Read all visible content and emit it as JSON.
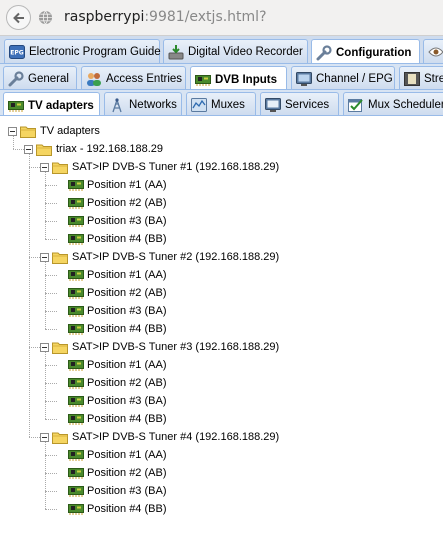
{
  "browser": {
    "url_host": "raspberrypi",
    "url_rest": ":9981/extjs.html?"
  },
  "main_tabs": [
    {
      "label": "Electronic Program Guide",
      "icon": "epg-icon"
    },
    {
      "label": "Digital Video Recorder",
      "icon": "dvr-icon"
    },
    {
      "label": "Configuration",
      "icon": "wrench-icon",
      "active": true
    },
    {
      "label": "",
      "icon": "eye-icon"
    }
  ],
  "config_tabs": [
    {
      "label": "General",
      "icon": "wrench-icon"
    },
    {
      "label": "Access Entries",
      "icon": "users-icon"
    },
    {
      "label": "DVB Inputs",
      "icon": "tuner-card-icon",
      "active": true
    },
    {
      "label": "Channel / EPG",
      "icon": "tv-icon"
    },
    {
      "label": "Stre",
      "icon": "film-icon"
    }
  ],
  "dvb_tabs": [
    {
      "label": "TV adapters",
      "icon": "tuner-card-icon",
      "active": true
    },
    {
      "label": "Networks",
      "icon": "antenna-icon"
    },
    {
      "label": "Muxes",
      "icon": "mux-icon"
    },
    {
      "label": "Services",
      "icon": "tv-services-icon"
    },
    {
      "label": "Mux Schedulers",
      "icon": "scheduler-icon"
    }
  ],
  "tree": {
    "root": "TV adapters",
    "device": "triax - 192.168.188.29",
    "tuners": [
      {
        "label": "SAT>IP DVB-S Tuner #1 (192.168.188.29)",
        "positions": [
          "Position #1 (AA)",
          "Position #2 (AB)",
          "Position #3 (BA)",
          "Position #4 (BB)"
        ]
      },
      {
        "label": "SAT>IP DVB-S Tuner #2 (192.168.188.29)",
        "positions": [
          "Position #1 (AA)",
          "Position #2 (AB)",
          "Position #3 (BA)",
          "Position #4 (BB)"
        ]
      },
      {
        "label": "SAT>IP DVB-S Tuner #3 (192.168.188.29)",
        "positions": [
          "Position #1 (AA)",
          "Position #2 (AB)",
          "Position #3 (BA)",
          "Position #4 (BB)"
        ]
      },
      {
        "label": "SAT>IP DVB-S Tuner #4 (192.168.188.29)",
        "positions": [
          "Position #1 (AA)",
          "Position #2 (AB)",
          "Position #3 (BA)",
          "Position #4 (BB)"
        ]
      }
    ]
  },
  "colors": {
    "tab_border": "#99bbe8",
    "folder_yellow": "#f5d561",
    "card_green": "#4a8a2c"
  }
}
